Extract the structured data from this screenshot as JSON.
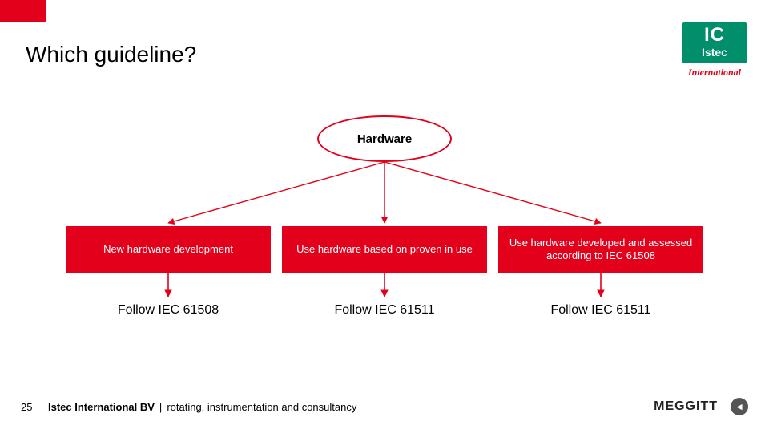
{
  "title": "Which guideline?",
  "logo": {
    "ic_top": "IC",
    "ic_bot": "Istec",
    "intl": "International"
  },
  "root_node": "Hardware",
  "branches": [
    {
      "box": "New hardware development",
      "follow": "Follow IEC 61508"
    },
    {
      "box": "Use hardware based on proven in use",
      "follow": "Follow  IEC 61511"
    },
    {
      "box": "Use hardware developed and assessed according to IEC 61508",
      "follow": "Follow  IEC 61511"
    }
  ],
  "footer": {
    "page": "25",
    "company": "Istec International BV",
    "separator": "|",
    "tagline": "rotating, instrumentation and consultancy",
    "partner": "MEGGITT",
    "back_glyph": "◄"
  },
  "colors": {
    "accent": "#e2001a",
    "green": "#008e6b"
  }
}
